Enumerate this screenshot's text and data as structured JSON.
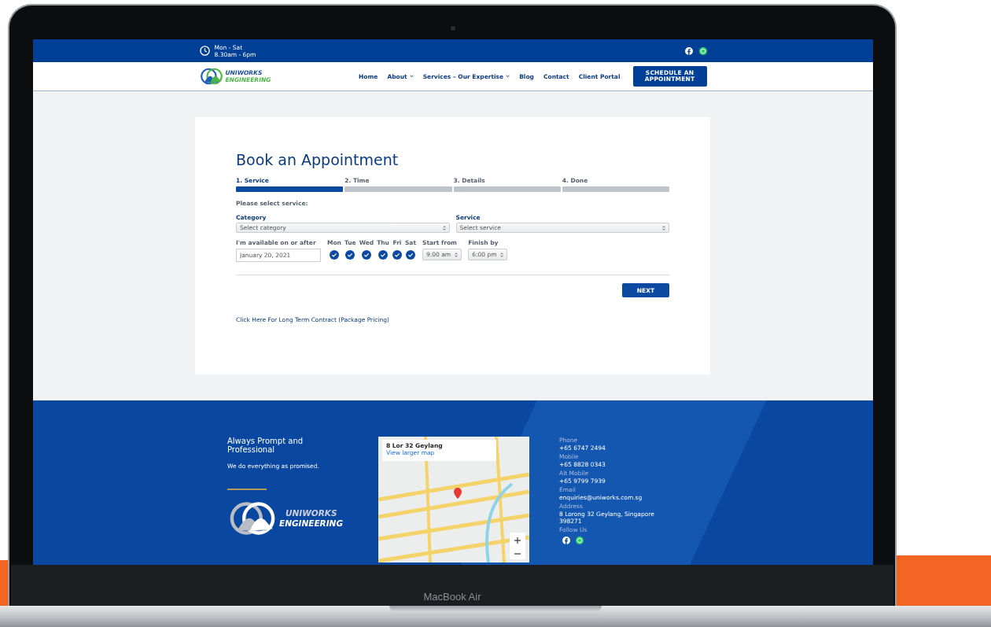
{
  "topbar": {
    "hours_line1": "Mon - Sat",
    "hours_line2": "8.30am - 6pm"
  },
  "nav": {
    "logo_line1": "UNIWORKS",
    "logo_line2": "ENGINEERING",
    "items": [
      {
        "label": "Home",
        "has_dropdown": false
      },
      {
        "label": "About",
        "has_dropdown": true
      },
      {
        "label": "Services – Our Expertise",
        "has_dropdown": true
      },
      {
        "label": "Blog",
        "has_dropdown": false
      },
      {
        "label": "Contact",
        "has_dropdown": false
      },
      {
        "label": "Client Portal",
        "has_dropdown": false
      }
    ],
    "cta": "SCHEDULE AN APPOINTMENT"
  },
  "booking": {
    "title": "Book an Appointment",
    "steps": [
      {
        "label": "1. Service",
        "selected": true
      },
      {
        "label": "2. Time",
        "selected": false
      },
      {
        "label": "3. Details",
        "selected": false
      },
      {
        "label": "4. Done",
        "selected": false
      }
    ],
    "prompt": "Please select service:",
    "selects": [
      {
        "label": "Category",
        "value": "Select category"
      },
      {
        "label": "Service",
        "value": "Select service"
      }
    ],
    "availability_label": "I'm available on or after",
    "date_value": "January 20, 2021",
    "days": [
      {
        "label": "Mon",
        "checked": true
      },
      {
        "label": "Tue",
        "checked": true
      },
      {
        "label": "Wed",
        "checked": true
      },
      {
        "label": "Thu",
        "checked": true
      },
      {
        "label": "Fri",
        "checked": true
      },
      {
        "label": "Sat",
        "checked": true
      }
    ],
    "start_label": "Start from",
    "start_value": "9:00 am",
    "finish_label": "Finish by",
    "finish_value": "6:00 pm",
    "next": "NEXT",
    "contract_link": "Click Here For Long Term Contract (Package Pricing)"
  },
  "footer": {
    "heading": "Always Prompt and Professional",
    "tagline": "We do everything as promised.",
    "logo_line1": "UNIWORKS",
    "logo_line2": "ENGINEERING",
    "map": {
      "title": "8 Lor 32 Geylang",
      "link": "View larger map"
    },
    "contacts": [
      {
        "label": "Phone",
        "value": "+65 6747 2494"
      },
      {
        "label": "Mobile",
        "value": "+65 8828 0343"
      },
      {
        "label": "Alt Mobile",
        "value": "+65 9799 7939"
      },
      {
        "label": "Email",
        "value": "enquiries@uniworks.com.sg"
      },
      {
        "label": "Address",
        "value": "8 Lorong 32 Geylang, Singapore 398271"
      }
    ],
    "follow_label": "Follow Us"
  },
  "device": {
    "model": "MacBook Air"
  }
}
